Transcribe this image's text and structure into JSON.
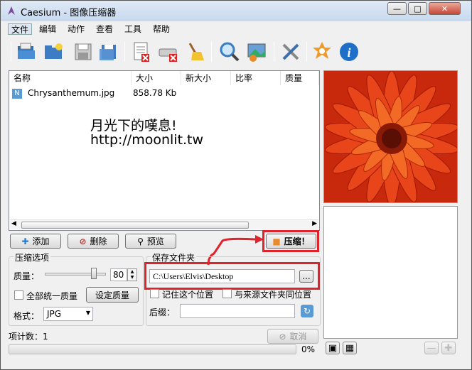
{
  "window": {
    "title": "Caesium - 图像压缩器"
  },
  "menu": [
    "文件",
    "编辑",
    "动作",
    "查看",
    "工具",
    "帮助"
  ],
  "toolbar": [
    "open-folder-icon",
    "open-image-icon",
    "save-icon",
    "save-as-icon",
    "remove-list-icon",
    "clear-drive-icon",
    "broom-icon",
    "zoom-icon",
    "preview-image-icon",
    "tools-icon",
    "settings-icon",
    "info-icon"
  ],
  "list": {
    "columns": [
      "名称",
      "大小",
      "新大小",
      "比率",
      "质量"
    ],
    "rows": [
      {
        "name": "Chrysanthemum.jpg",
        "size": "858.78 Kb"
      }
    ],
    "watermark1": "月光下的嘆息!",
    "watermark2": "http://moonlit.tw"
  },
  "buttons": {
    "add": "添加",
    "remove": "删除",
    "preview": "预览",
    "compress": "压缩！",
    "cancel": "取消",
    "set_quality": "设定质量",
    "browse": "..."
  },
  "options": {
    "title": "压缩选项",
    "quality_label": "质量：",
    "quality_value": "80",
    "quality_fraction": 0.8,
    "same_quality_label": "全部统一质量",
    "format_label": "格式：",
    "format_value": "JPG"
  },
  "output": {
    "title": "保存文件夹",
    "path": "C:\\Users\\Elvis\\Desktop",
    "remember_label": "记住这个位置",
    "same_as_source_label": "与来源文件夹同位置",
    "suffix_label": "后缀："
  },
  "status": {
    "count": "项计数：1",
    "percent": "0%"
  },
  "colors": {
    "highlight": "#e0222a",
    "accent": "#3a8fd8"
  }
}
